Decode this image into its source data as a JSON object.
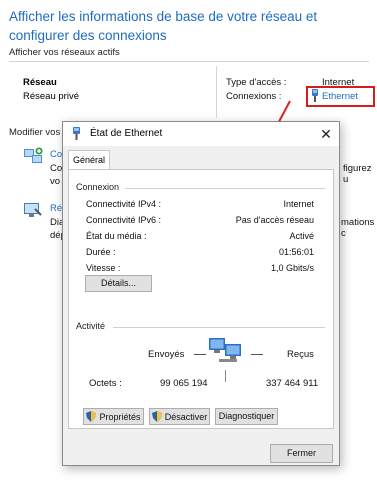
{
  "background": {
    "title": "Afficher les informations de base de votre réseau et configurer des connexions",
    "active_networks_heading": "Afficher vos réseaux actifs",
    "network_name": "Réseau",
    "network_profile": "Réseau privé",
    "access_type_label": "Type d'accès :",
    "access_type_value": "Internet",
    "connections_label": "Connexions :",
    "connection_link": "Ethernet",
    "modify_heading": "Modifier vos",
    "item1_label": "Co",
    "item1_line2": "Co",
    "item1_line3": "vo",
    "item1_side": "figurez u",
    "item2_label": "Rés",
    "item2_line2": "Dia",
    "item2_line3": "dép",
    "item2_side": "mations c",
    "highlight_color": "#d21e1e"
  },
  "dialog": {
    "title": "État de Ethernet",
    "close_glyph": "✕",
    "tab_general": "Général",
    "connection_group": "Connexion",
    "properties": [
      {
        "label": "Connectivité IPv4 :",
        "value": "Internet"
      },
      {
        "label": "Connectivité IPv6 :",
        "value": "Pas d'accès réseau"
      },
      {
        "label": "État du média :",
        "value": "Activé"
      },
      {
        "label": "Durée :",
        "value": "01:56:01"
      },
      {
        "label": "Vitesse :",
        "value": "1,0 Gbits/s"
      }
    ],
    "details_button": "Détails...",
    "activity_group": "Activité",
    "sent_label": "Envoyés",
    "received_label": "Reçus",
    "octets_label": "Octets :",
    "octets_sent": "99 065 194",
    "octets_received": "337 464 911",
    "properties_button": "Propriétés",
    "disable_button": "Désactiver",
    "diagnose_button": "Diagnostiquer",
    "close_button": "Fermer"
  }
}
